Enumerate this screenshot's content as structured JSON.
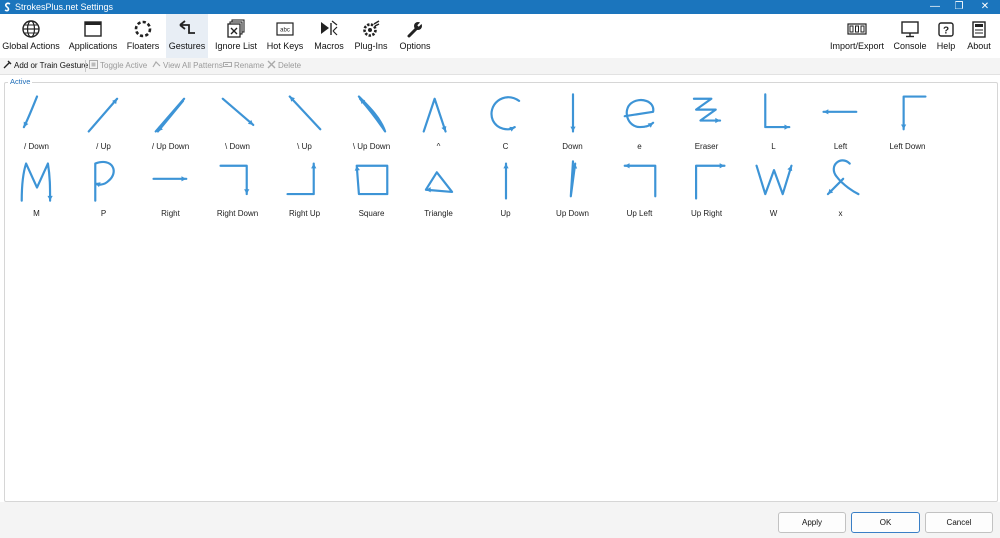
{
  "window": {
    "title": "StrokesPlus.net Settings"
  },
  "toolbar": {
    "global_actions": "Global Actions",
    "applications": "Applications",
    "floaters": "Floaters",
    "gestures": "Gestures",
    "ignore_list": "Ignore List",
    "hot_keys": "Hot Keys",
    "macros": "Macros",
    "plugins": "Plug-Ins",
    "options": "Options",
    "import_export": "Import/Export",
    "console": "Console",
    "help": "Help",
    "about": "About",
    "hotkey_icon_text": "abc"
  },
  "subtoolbar": {
    "add_train": "Add or Train Gesture",
    "toggle_active": "Toggle Active",
    "view_all_patterns": "View All Patterns",
    "rename": "Rename",
    "delete": "Delete"
  },
  "group": {
    "label": "Active"
  },
  "gestures": [
    "/ Down",
    "/ Up",
    "/ Up Down",
    "\\ Down",
    "\\ Up",
    "\\ Up Down",
    "^",
    "C",
    "Down",
    "e",
    "Eraser",
    "L",
    "Left",
    "Left Down",
    "M",
    "P",
    "Right",
    "Right Down",
    "Right Up",
    "Square",
    "Triangle",
    "Up",
    "Up Down",
    "Up Left",
    "Up Right",
    "W",
    "x"
  ],
  "footer": {
    "apply": "Apply",
    "ok": "OK",
    "cancel": "Cancel"
  },
  "colors": {
    "titlebar": "#1b75bd",
    "stroke": "#3d94d6",
    "group_label": "#1e6db8"
  }
}
